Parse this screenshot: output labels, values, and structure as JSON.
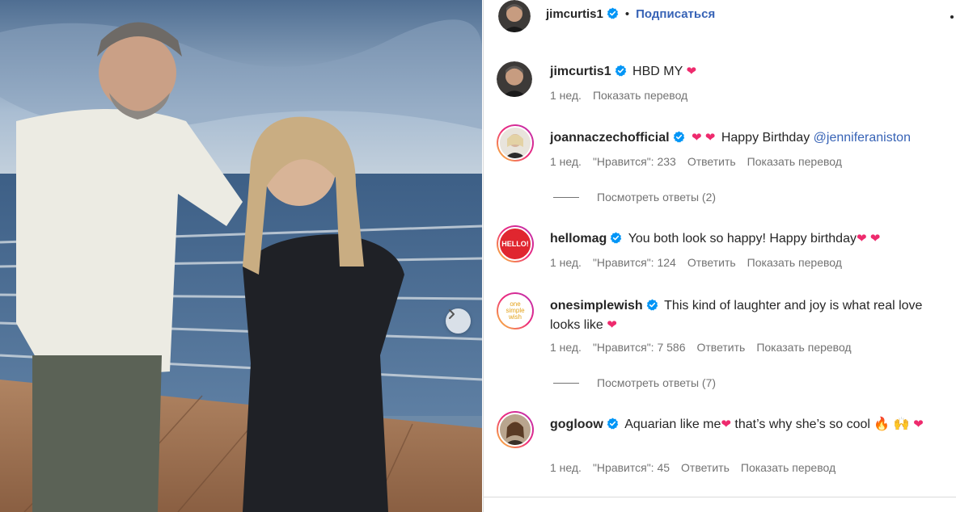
{
  "header": {
    "username": "jimcurtis1",
    "separator": "•",
    "follow_label": "Подписаться"
  },
  "caption": {
    "username": "jimcurtis1",
    "text": "HBD MY",
    "emoji": "❤",
    "time": "1 нед.",
    "translate": "Показать перевод"
  },
  "comments": [
    {
      "username": "joannaczechofficial",
      "text": "Happy Birthday",
      "emoji_before": "❤ ❤",
      "mention": "@jenniferaniston",
      "time": "1 нед.",
      "likes": "\"Нравится\": 233",
      "reply": "Ответить",
      "translate": "Показать перевод",
      "view_replies": "Посмотреть ответы (2)"
    },
    {
      "username": "hellomag",
      "text": "You both look so happy! Happy birthday",
      "emoji_after": "❤ ❤",
      "avatar_text": "HELLO!",
      "time": "1 нед.",
      "likes": "\"Нравится\": 124",
      "reply": "Ответить",
      "translate": "Показать перевод"
    },
    {
      "username": "onesimplewish",
      "text": "This kind of laughter and joy is what real love looks like",
      "emoji_after": "❤",
      "avatar_text": "one simple wish",
      "time": "1 нед.",
      "likes": "\"Нравится\": 7 586",
      "reply": "Ответить",
      "translate": "Показать перевод",
      "view_replies": "Посмотреть ответы (7)"
    },
    {
      "username": "gogloow",
      "text": "Aquarian like me",
      "text2": "that’s why she’s so cool",
      "emoji_mid": "❤",
      "emoji_end": "🔥 🙌",
      "emoji_wrap": "❤",
      "time": "1 нед.",
      "likes": "\"Нравится\": 45",
      "reply": "Ответить",
      "translate": "Показать перевод"
    }
  ],
  "colors": {
    "verified": "#0095f6",
    "link": "#3763b6",
    "heart": "#ee2a6d",
    "meta": "#737373"
  },
  "icons": {
    "verified": "verified-badge-icon",
    "next": "chevron-right-icon",
    "more": "more-options-icon"
  }
}
